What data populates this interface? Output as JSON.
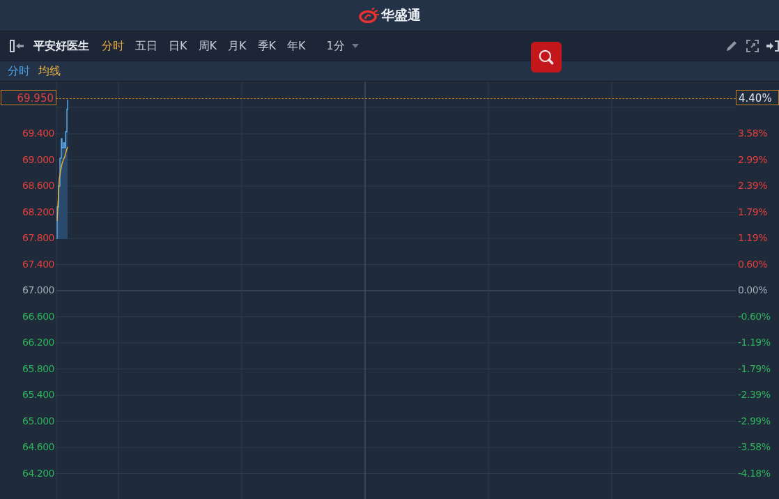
{
  "header": {
    "brand": "华盛通"
  },
  "toolbar": {
    "stock_name": "平安好医生",
    "tabs": [
      {
        "label": "分时",
        "selected": true
      },
      {
        "label": "五日",
        "selected": false
      },
      {
        "label": "日K",
        "selected": false
      },
      {
        "label": "周K",
        "selected": false
      },
      {
        "label": "月K",
        "selected": false
      },
      {
        "label": "季K",
        "selected": false
      },
      {
        "label": "年K",
        "selected": false
      }
    ],
    "interval": "1分"
  },
  "legend": [
    {
      "label": "分时",
      "color": "#4a9fe0"
    },
    {
      "label": "均线",
      "color": "#e8b040"
    }
  ],
  "chart": {
    "current_price": "69.950",
    "current_change": "4.40%",
    "price_ticks": [
      {
        "label": "69.400",
        "color": "#e0403e"
      },
      {
        "label": "69.000",
        "color": "#e0403e"
      },
      {
        "label": "68.600",
        "color": "#e0403e"
      },
      {
        "label": "68.200",
        "color": "#e0403e"
      },
      {
        "label": "67.800",
        "color": "#e0403e"
      },
      {
        "label": "67.400",
        "color": "#e0403e"
      },
      {
        "label": "67.000",
        "color": "#a3abb7"
      },
      {
        "label": "66.600",
        "color": "#2fb35a"
      },
      {
        "label": "66.200",
        "color": "#2fb35a"
      },
      {
        "label": "65.800",
        "color": "#2fb35a"
      },
      {
        "label": "65.400",
        "color": "#2fb35a"
      },
      {
        "label": "65.000",
        "color": "#2fb35a"
      },
      {
        "label": "64.600",
        "color": "#2fb35a"
      },
      {
        "label": "64.200",
        "color": "#2fb35a"
      }
    ],
    "change_ticks": [
      {
        "label": "3.58%",
        "color": "#e0403e"
      },
      {
        "label": "2.99%",
        "color": "#e0403e"
      },
      {
        "label": "2.39%",
        "color": "#e0403e"
      },
      {
        "label": "1.79%",
        "color": "#e0403e"
      },
      {
        "label": "1.19%",
        "color": "#e0403e"
      },
      {
        "label": "0.60%",
        "color": "#e0403e"
      },
      {
        "label": "0.00%",
        "color": "#a3abb7"
      },
      {
        "label": "-0.60%",
        "color": "#2fb35a"
      },
      {
        "label": "-1.19%",
        "color": "#2fb35a"
      },
      {
        "label": "-1.79%",
        "color": "#2fb35a"
      },
      {
        "label": "-2.39%",
        "color": "#2fb35a"
      },
      {
        "label": "-2.99%",
        "color": "#2fb35a"
      },
      {
        "label": "-3.58%",
        "color": "#2fb35a"
      },
      {
        "label": "-4.18%",
        "color": "#2fb35a"
      }
    ]
  }
}
